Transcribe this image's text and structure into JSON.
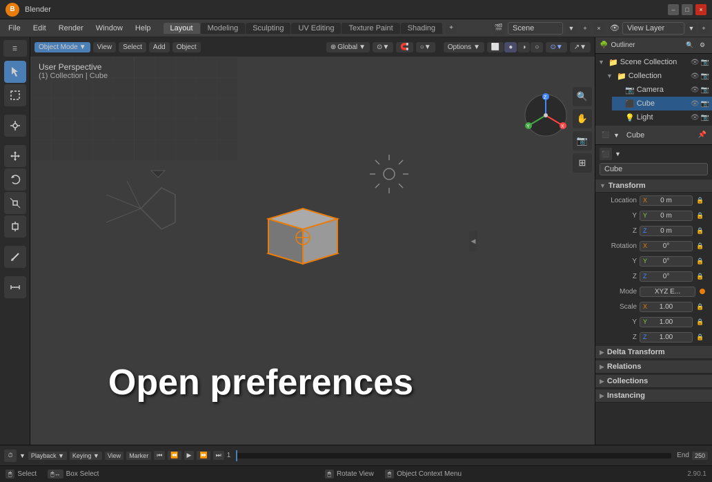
{
  "titlebar": {
    "logo": "B",
    "title": "Blender",
    "minimize": "–",
    "maximize": "□",
    "close": "×"
  },
  "menubar": {
    "items": [
      "File",
      "Edit",
      "Render",
      "Window",
      "Help"
    ]
  },
  "workspace_tabs": {
    "tabs": [
      "Layout",
      "Modeling",
      "Sculpting",
      "UV Editing",
      "Texture Paint",
      "Shading"
    ],
    "active": "Layout"
  },
  "scene_selector": {
    "label": "Scene",
    "value": "Scene",
    "icon": "scene-icon"
  },
  "view_layer": {
    "label": "View Layer",
    "value": "View Layer"
  },
  "viewport": {
    "mode": "Object Mode",
    "view_label": "View",
    "select_label": "Select",
    "add_label": "Add",
    "object_label": "Object",
    "perspective": "User Perspective",
    "collection_info": "(1) Collection | Cube",
    "transform": "Global"
  },
  "left_toolbar": {
    "tools": [
      "cursor",
      "move",
      "rotate",
      "scale",
      "transform",
      "annotate",
      "measure"
    ]
  },
  "outliner": {
    "title": "Outliner",
    "scene_collection": "Scene Collection",
    "collection": "Collection",
    "camera": "Camera",
    "cube": "Cube",
    "light": "Light"
  },
  "properties": {
    "panel_title": "Cube",
    "object_name": "Cube",
    "sections": {
      "transform": "Transform",
      "location": {
        "label": "Location",
        "x_label": "X",
        "y_label": "Y",
        "z_label": "Z",
        "x_val": "0 m",
        "y_val": "0 m",
        "z_val": "0 m"
      },
      "rotation": {
        "label": "Rotation",
        "x_label": "X",
        "y_label": "Y",
        "z_label": "Z",
        "x_val": "0°",
        "y_val": "0°",
        "z_val": "0°",
        "mode_label": "Mode",
        "mode_val": "XYZ E..."
      },
      "scale": {
        "label": "Scale",
        "x_label": "X",
        "y_label": "Y",
        "z_label": "Z",
        "x_val": "1.00",
        "y_val": "1.00",
        "z_val": "1.00"
      },
      "delta_transform": "Delta Transform",
      "relations": "Relations",
      "collections": "Collections",
      "instancing": "Instancing"
    }
  },
  "timeline": {
    "start_label": "1",
    "end_label": "End",
    "end_val": "250",
    "playback_label": "Playback",
    "keying_label": "Keying",
    "view_label": "View",
    "marker_label": "Marker"
  },
  "statusbar": {
    "select_label": "Select",
    "box_select_label": "Box Select",
    "rotate_view_label": "Rotate View",
    "context_label": "Object Context Menu",
    "version": "2.90.1"
  },
  "overlay_text": "Open preferences",
  "colors": {
    "accent": "#e87d0d",
    "blue": "#4a7eb5",
    "selected_bg": "#1e4c7a",
    "active_bg": "#2b5a8a"
  }
}
